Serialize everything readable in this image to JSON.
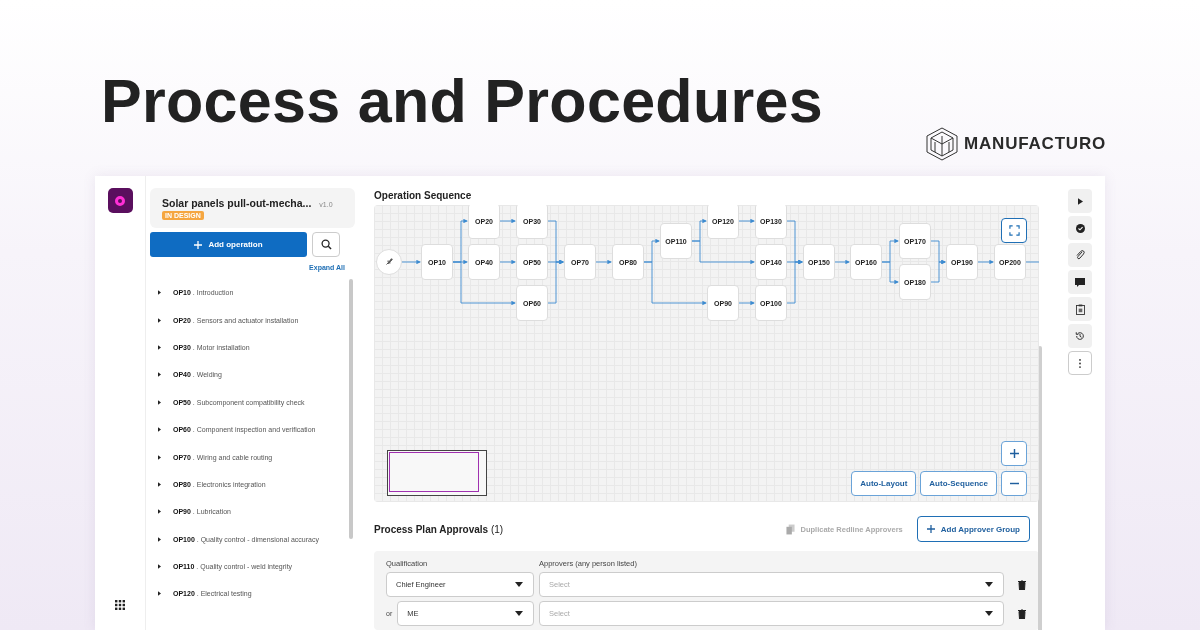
{
  "headline": "Process and Procedures",
  "brand": "MANUFACTURO",
  "plan": {
    "title": "Solar panels pull-out-mecha...",
    "version": "v1.0",
    "status": "IN DESIGN"
  },
  "add_operation": "Add operation",
  "expand_all": "Expand All",
  "operations": [
    {
      "label": "**OP10** . Introduction"
    },
    {
      "label": "**OP20** . Sensors and actuator installation"
    },
    {
      "label": "**OP30** . Motor installation"
    },
    {
      "label": "**OP40** . Welding"
    },
    {
      "label": "**OP50** . Subcomponent compatibility check"
    },
    {
      "label": "**OP60** . Component inspection and verification"
    },
    {
      "label": "**OP70** . Wiring and cable routing"
    },
    {
      "label": "**OP80** . Electronics integration"
    },
    {
      "label": "**OP90** . Lubrication"
    },
    {
      "label": "**OP100** . Quality control - dimensional accuracy"
    },
    {
      "label": "**OP110** . Quality control - weld integrity"
    },
    {
      "label": "**OP120** . Electrical testing"
    }
  ],
  "sequence": {
    "title": "Operation Sequence",
    "nodes": [
      "OP10",
      "OP20",
      "OP30",
      "OP40",
      "OP50",
      "OP60",
      "OP70",
      "OP80",
      "OP110",
      "OP120",
      "OP130",
      "OP140",
      "OP90",
      "OP100",
      "OP150",
      "OP160",
      "OP170",
      "OP180",
      "OP190",
      "OP200"
    ],
    "buttons": [
      "Auto-Layout",
      "Auto-Sequence"
    ]
  },
  "approvals": {
    "title": "Process Plan Approvals",
    "count": "(1)",
    "duplicate": {
      "label": "Duplicate Redline Approvers",
      "disabled": true
    },
    "add_group": "Add Approver Group",
    "qualification_label": "Qualification",
    "approvers_label": "Approvers (any person listed)",
    "rows": [
      {
        "qualification": "Chief Engineer",
        "approvers_placeholder": "Select"
      },
      {
        "connector": "or",
        "qualification": "ME",
        "approvers_placeholder": "Select"
      }
    ]
  }
}
